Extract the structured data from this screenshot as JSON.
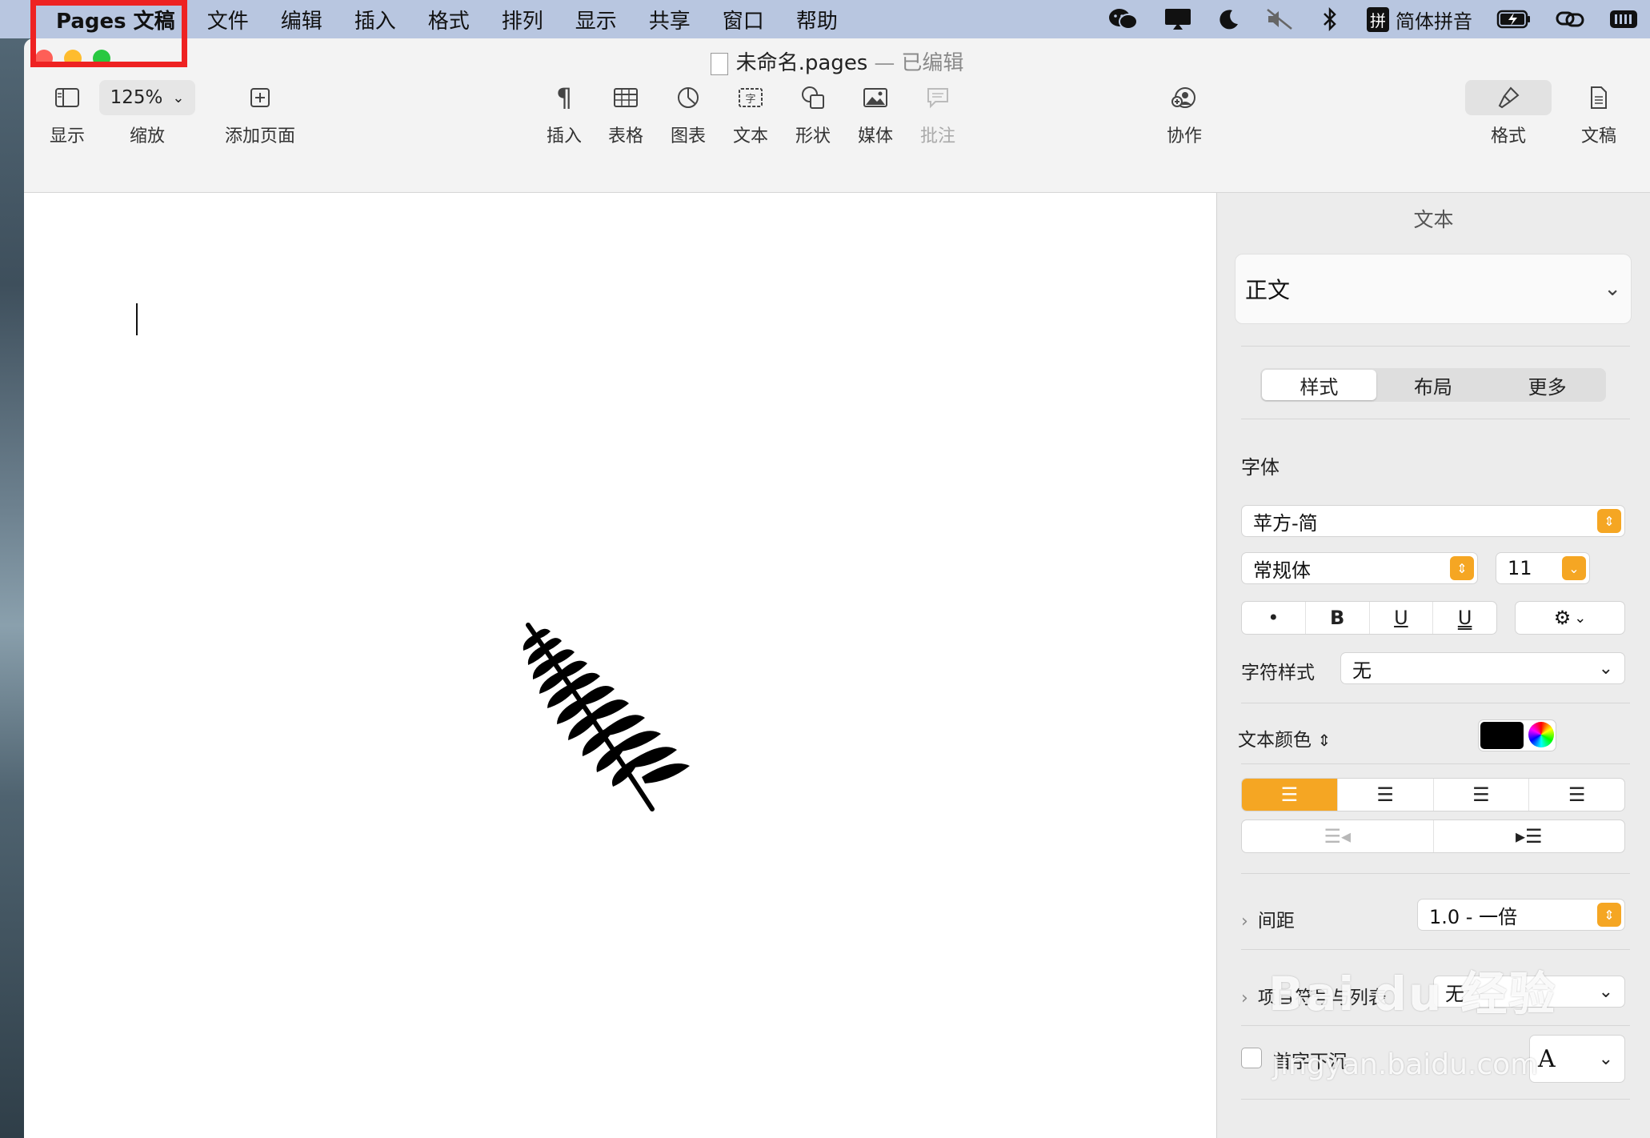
{
  "menubar": {
    "apple": "",
    "app_name": "Pages 文稿",
    "items": [
      "文件",
      "编辑",
      "插入",
      "格式",
      "排列",
      "显示",
      "共享",
      "窗口",
      "帮助"
    ],
    "input_method": "简体拼音",
    "ime_badge": "拼"
  },
  "window": {
    "title": "未命名.pages",
    "title_sep": "—",
    "status": "已编辑"
  },
  "toolbar": {
    "view_label": "显示",
    "zoom_value": "125%",
    "zoom_label": "缩放",
    "add_page_label": "添加页面",
    "insert_label": "插入",
    "table_label": "表格",
    "chart_label": "图表",
    "text_label": "文本",
    "shape_label": "形状",
    "media_label": "媒体",
    "comment_label": "批注",
    "collaborate_label": "协作",
    "format_label": "格式",
    "document_label": "文稿"
  },
  "inspector": {
    "title": "文本",
    "paragraph_style": "正文",
    "tabs": [
      "样式",
      "布局",
      "更多"
    ],
    "font_section": "字体",
    "font_family": "苹方-简",
    "font_weight": "常规体",
    "font_size": "11",
    "format_buttons": [
      "•",
      "B",
      "U",
      "U"
    ],
    "char_style_label": "字符样式",
    "char_style_value": "无",
    "text_color_label": "文本颜色",
    "text_color": "#000000",
    "spacing_label": "间距",
    "spacing_value": "1.0 - 一倍",
    "bullets_label": "项目符号与列表",
    "bullets_value": "无",
    "dropcap_label": "首字下沉",
    "dropcap_glyph": "A"
  },
  "watermark": {
    "brand": "Bai du 经验",
    "url": "jingyan.baidu.com"
  },
  "colors": {
    "accent": "#f5a623",
    "highlight_box": "#ee2222",
    "menubar_bg": "#b8c6e0"
  }
}
